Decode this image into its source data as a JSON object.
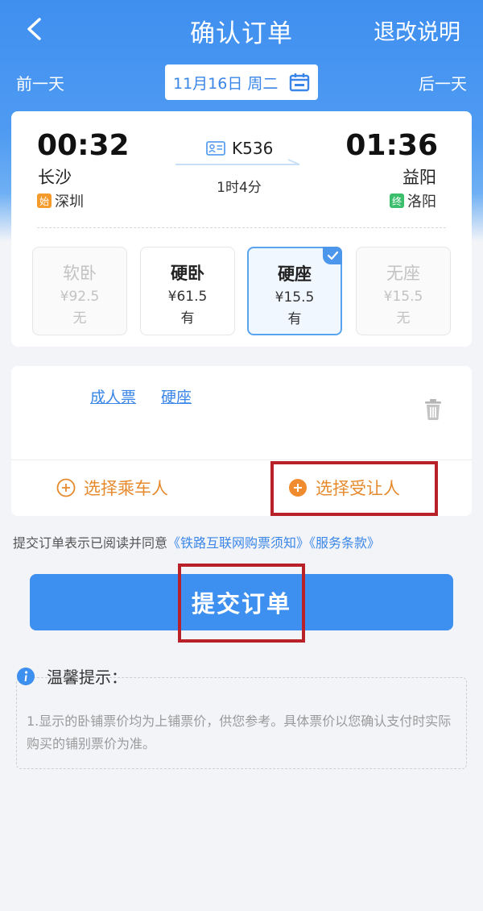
{
  "nav": {
    "title": "确认订单",
    "refund_link": "退改说明"
  },
  "date_row": {
    "prev": "前一天",
    "next": "后一天",
    "date": "11月16日 周二"
  },
  "train": {
    "number": "K536",
    "departure_time": "00:32",
    "arrival_time": "01:36",
    "departure_station": "长沙",
    "arrival_station": "益阳",
    "origin_tag": "始",
    "origin": "深圳",
    "destination_tag": "终",
    "destination": "洛阳",
    "duration": "1时4分"
  },
  "seats": [
    {
      "name": "软卧",
      "price": "¥92.5",
      "availability": "无",
      "state": "disabled"
    },
    {
      "name": "硬卧",
      "price": "¥61.5",
      "availability": "有",
      "state": "normal"
    },
    {
      "name": "硬座",
      "price": "¥15.5",
      "availability": "有",
      "state": "selected"
    },
    {
      "name": "无座",
      "price": "¥15.5",
      "availability": "无",
      "state": "disabled"
    }
  ],
  "passenger": {
    "ticket_type": "成人票",
    "seat_type": "硬座",
    "select_passenger": "选择乘车人",
    "select_transferee": "选择受让人"
  },
  "agreement": {
    "prefix": "提交订单表示已阅读并同意",
    "link1": "《铁路互联网购票须知》",
    "link2": "《服务条款》"
  },
  "submit": {
    "label": "提交订单"
  },
  "tips": {
    "title": "温馨提示：",
    "text": "1.显示的卧铺票价均为上铺票价，供您参考。具体票价以您确认支付时实际购买的铺别票价为准。"
  },
  "colors": {
    "primary": "#3d8ff0",
    "link": "#3a86e8",
    "accent_orange": "#e68a2e",
    "annotation_red": "#b8202a"
  },
  "icons": {
    "back": "back-arrow-icon",
    "calendar": "calendar-icon",
    "train_id": "id-card-icon",
    "trash": "trash-icon",
    "add": "plus-circle-icon",
    "info": "info-icon",
    "check": "check-icon"
  }
}
